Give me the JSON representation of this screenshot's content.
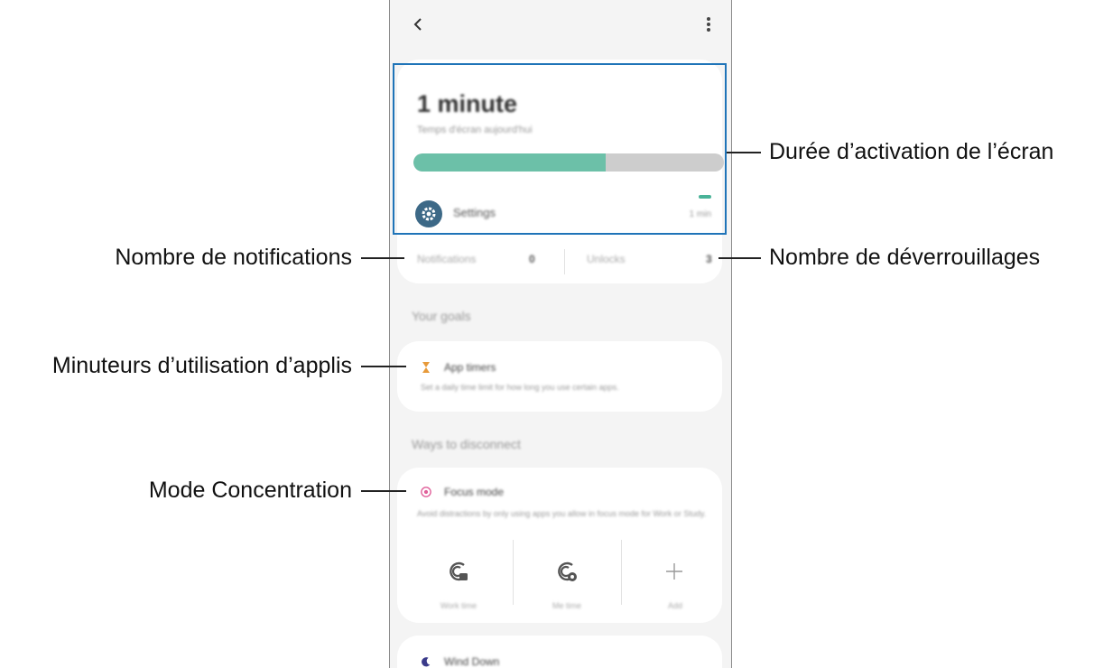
{
  "screen": {
    "usage_time": "1 minute",
    "usage_sub": "Temps d'écran aujourd'hui",
    "usage_fraction": 0.62,
    "app_name": "Settings",
    "app_value": "1 min",
    "notifications_label": "Notifications",
    "notifications_count": "0",
    "unlocks_label": "Unlocks",
    "unlocks_count": "3",
    "goals_title": "Your goals",
    "timers_title": "App timers",
    "timers_desc": "Set a daily time limit for how long you use certain apps.",
    "apps_title": "Ways to disconnect",
    "focus_title": "Focus mode",
    "focus_desc": "Avoid distractions by only using apps you allow in focus mode for Work or Study.",
    "modes": [
      "Work time",
      "Me time",
      "Add"
    ],
    "wind_title": "Wind Down"
  },
  "annotations": {
    "screen_time": "Durée d’activation de l’écran",
    "notifications": "Nombre de notifications",
    "unlocks": "Nombre de déverrouillages",
    "app_timers": "Minuteurs d’utilisation d’applis",
    "focus_mode": "Mode Concentration"
  },
  "colors": {
    "highlight": "#1f74b8",
    "bar_fill": "#6cc0a8",
    "focus_icon": "#e0609a",
    "timer_icon": "#e79a3a"
  }
}
